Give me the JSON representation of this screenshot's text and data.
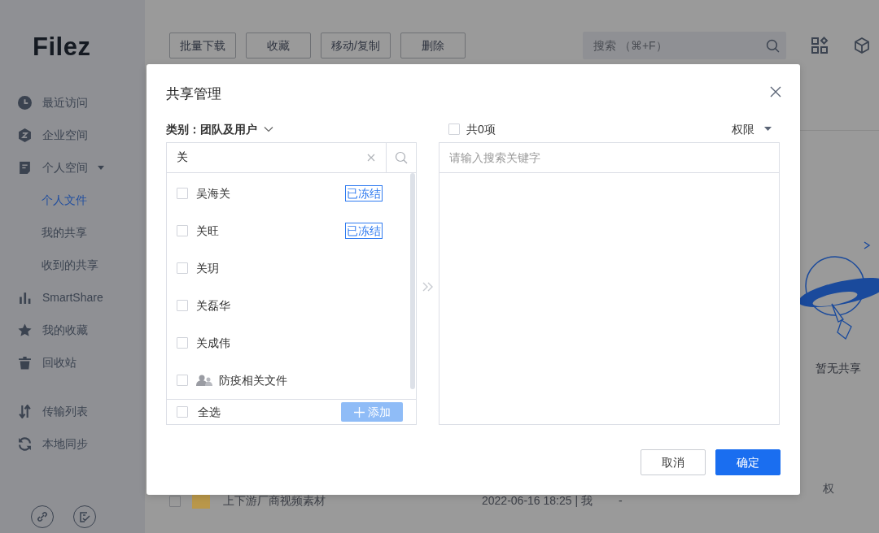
{
  "sidebar": {
    "logo": "Filez",
    "items": [
      {
        "label": "最近访问",
        "selected": false
      },
      {
        "label": "企业空间",
        "selected": false
      },
      {
        "label": "个人空间",
        "selected": false,
        "expanded": true,
        "children": [
          {
            "label": "个人文件",
            "selected": true
          },
          {
            "label": "我的共享",
            "selected": false
          },
          {
            "label": "收到的共享",
            "selected": false
          }
        ]
      },
      {
        "label": "SmartShare",
        "selected": false
      },
      {
        "label": "我的收藏",
        "selected": false
      },
      {
        "label": "回收站",
        "selected": false
      }
    ],
    "tools": [
      {
        "label": "传输列表",
        "selected": false
      },
      {
        "label": "本地同步",
        "selected": false
      }
    ]
  },
  "toolbar": {
    "buttons": [
      "批量下载",
      "收藏",
      "移动/复制",
      "删除"
    ],
    "search": {
      "placeholder": "搜索 （⌘+F）"
    }
  },
  "empty_state": {
    "text": "暂无共享"
  },
  "file_row": {
    "checked": false,
    "name": "上下游厂商视频素材",
    "modified": "2022-06-16 18:25 | 我",
    "size": "-",
    "column_4": "权"
  },
  "dialog": {
    "title": "共享管理",
    "category": {
      "label": "类别：",
      "value": "团队及用户"
    },
    "search": {
      "value": "关"
    },
    "results": [
      {
        "kind": "user",
        "name": "吴海关",
        "checked": false,
        "tag": "已冻结"
      },
      {
        "kind": "user",
        "name": "关旺",
        "checked": false,
        "tag": "已冻结"
      },
      {
        "kind": "user",
        "name": "关玥",
        "checked": false
      },
      {
        "kind": "user",
        "name": "关磊华",
        "checked": false
      },
      {
        "kind": "user",
        "name": "关成伟",
        "checked": false
      },
      {
        "kind": "team",
        "name": "防疫相关文件",
        "checked": false
      }
    ],
    "select_all": {
      "label": "全选",
      "checked": false
    },
    "add_button": {
      "label": "添加",
      "disabled": true
    },
    "selected_panel": {
      "count": "共0项",
      "checked": false,
      "permission": "权限",
      "search": {
        "placeholder": "请输入搜索关键字"
      }
    },
    "buttons": [
      {
        "kind": "secondary",
        "label": "取消"
      },
      {
        "kind": "primary",
        "label": "确定"
      }
    ]
  }
}
